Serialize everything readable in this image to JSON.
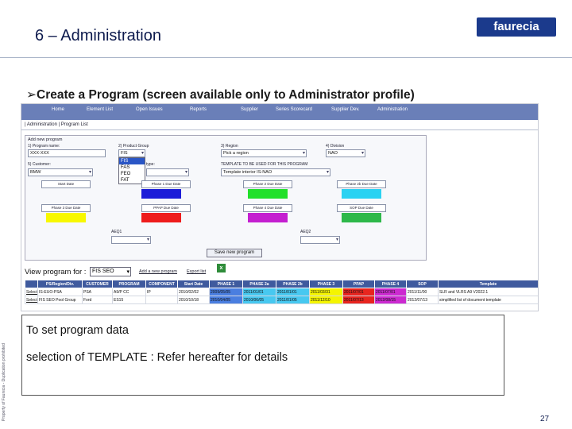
{
  "slide": {
    "title": "6 – Administration",
    "logo_text": "faurecia",
    "side_note": "Property of Faurecia - Duplication prohibited",
    "bullet_symbol": "➢",
    "bullet": "Create a Program  (screen available only to Administrator profile)",
    "note_line1": "To set   program  data",
    "note_line2": "selection of TEMPLATE :   Refer hereafter for details",
    "page_number": "27"
  },
  "app": {
    "nav": [
      "Home",
      "Element List",
      "Open Issues",
      "Reports",
      "Supplier",
      "Series Scorecard",
      "Supplier Dev.",
      "Administration"
    ],
    "breadcrumb": "| Administration | Program List",
    "form": {
      "title": "Add new program",
      "program_name_label": "1) Program name:",
      "program_name_value": "XXX-XXX",
      "product_group_label": "2) Product Group",
      "product_group_value": "FIS",
      "product_group_options": [
        "FIS",
        "FAS",
        "FEO",
        "FAT"
      ],
      "region_label": "3) Region",
      "region_value": "Pick a region",
      "division_label": "4) Division",
      "division_value": "NAO",
      "customer_label": "5) Customer:",
      "customer_value": "BMW",
      "type_label": "type:",
      "template_label": "TEMPLATE TO BE USED FOR THIS PROGRAM",
      "template_value": "Template interior IS-NAO",
      "start_date": "Start Date",
      "phase1_date": "Phase 1 Due Date",
      "phase2_date": "Phase 2 Due Date",
      "phase2b_date": "Phase 2b Due Date",
      "phase3_date": "Phase 3 Due Date",
      "ppap_date": "PPAP Due Date",
      "phase4_date": "Phase 4 Due Date",
      "sop_date": "SOP Due Date",
      "aeq1_label": "AEQ1",
      "aeq2_label": "AEQ2",
      "save_button": "Save new program"
    },
    "view": {
      "label": "View program for :",
      "select_value": "FIS SEO",
      "link1": "Add a new program",
      "link2": "Export list"
    },
    "table": {
      "headers": [
        "",
        "PS/Region/Div.",
        "CUSTOMER",
        "PROGRAM",
        "COMPONENT",
        "Start Date",
        "PHASE 1",
        "PHASE 2a",
        "PHASE 2b",
        "PHASE 3",
        "PPAP",
        "PHASE 4",
        "SOP",
        "Template"
      ],
      "rows": [
        [
          "Select",
          "IS-EUO-PSA",
          "PSA",
          "A9/P CC",
          "IP",
          "2010/02/02",
          "2009/05/05",
          "2011/01/01",
          "2011/01/01",
          "2011/03/31",
          "2011/07/01",
          "2011/07/01",
          "2011/11/00",
          "SLR and VLRS A9 V2022.1"
        ],
        [
          "Select",
          "FIS SEO Pool Group",
          "Ford",
          "ES15",
          "",
          "2010/10/18",
          "2010/04/05",
          "2010/06/05",
          "2011/01/05",
          "2011/12/10",
          "2011/07/13",
          "2012/08/15",
          "2012/07/13",
          "simplified list of document template"
        ]
      ],
      "cell_colors": [
        "#ffffff",
        "#ffffff",
        "#ffffff",
        "#ffffff",
        "#ffffff",
        "#ffffff",
        "#4a7ee0",
        "#47c8f0",
        "#47c8f0",
        "#f5f500",
        "#e8251f",
        "#cc2ad0",
        "#ffffff",
        "#ffffff"
      ]
    },
    "colors": {
      "phase1": "#1d1dd8",
      "phase2": "#22e02a",
      "phase2b": "#2ad2f2",
      "phase3": "#f8f800",
      "ppap": "#ee1c1c",
      "phase4": "#c41fd0",
      "sop": "#2eb84a"
    }
  }
}
